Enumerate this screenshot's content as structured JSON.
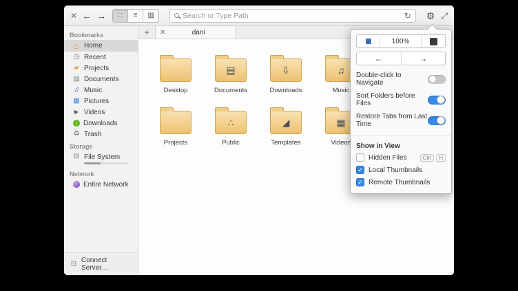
{
  "toolbar": {
    "search_placeholder": "Search or Type Path",
    "view_buttons": [
      {
        "name": "grid-view",
        "glyph": "∷",
        "active": true
      },
      {
        "name": "list-view",
        "glyph": "≡",
        "active": false
      },
      {
        "name": "column-view",
        "glyph": "▥",
        "active": false
      }
    ]
  },
  "sidebar": {
    "icons": {
      "home": "⌂",
      "recent": "◷",
      "projects": "▰",
      "documents": "▤",
      "music": "♫",
      "pictures": "▦",
      "videos": "▶",
      "downloads": "↓",
      "trash": "♻",
      "file_system": "⊟",
      "connect": "⊡"
    },
    "sections": [
      {
        "label": "Bookmarks",
        "items": [
          {
            "label": "Home",
            "selected": true
          },
          {
            "label": "Recent"
          },
          {
            "label": "Projects"
          },
          {
            "label": "Documents"
          },
          {
            "label": "Music"
          },
          {
            "label": "Pictures"
          },
          {
            "label": "Videos"
          },
          {
            "label": "Downloads"
          },
          {
            "label": "Trash"
          }
        ]
      },
      {
        "label": "Storage",
        "items": [
          {
            "label": "File System"
          }
        ]
      },
      {
        "label": "Network",
        "items": [
          {
            "label": "Entire Network"
          }
        ]
      }
    ],
    "connect_server": "Connect Server…"
  },
  "tabbar": {
    "new_tab": "+",
    "close": "✕",
    "active_tab": "dani"
  },
  "files": [
    {
      "name": "Desktop",
      "emblem": ""
    },
    {
      "name": "Documents",
      "emblem": "▤"
    },
    {
      "name": "Downloads",
      "emblem": "⇩"
    },
    {
      "name": "Music",
      "emblem": "♫"
    },
    {
      "name": "Projects",
      "emblem": ""
    },
    {
      "name": "Public",
      "emblem": "∴"
    },
    {
      "name": "Templates",
      "emblem": "◢"
    },
    {
      "name": "Videos",
      "emblem": "▦"
    }
  ],
  "popover": {
    "zoom_level": "100%",
    "back_glyph": "←",
    "forward_glyph": "→",
    "toggles": [
      {
        "label": "Double-click to Navigate",
        "on": false
      },
      {
        "label": "Sort Folders before Files",
        "on": true
      },
      {
        "label": "Restore Tabs from Last Time",
        "on": true
      }
    ],
    "show_in_view_header": "Show in View",
    "checkboxes": [
      {
        "label": "Hidden Files",
        "checked": false,
        "shortcut": [
          "Ctrl",
          "H"
        ]
      },
      {
        "label": "Local Thumbnails",
        "checked": true
      },
      {
        "label": "Remote Thumbnails",
        "checked": true
      }
    ]
  },
  "colors": {
    "accent": "#3689e6",
    "folder_fill": "#eec172",
    "selected_row": "#d9d8d6"
  }
}
